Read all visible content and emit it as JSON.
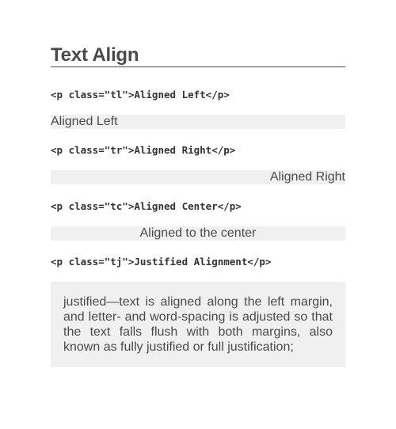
{
  "page": {
    "title": "Text Align"
  },
  "examples": [
    {
      "code": "<p class=\"tl\">Aligned Left</p>",
      "text": "Aligned Left"
    },
    {
      "code": "<p class=\"tr\">Aligned Right</p>",
      "text": "Aligned Right"
    },
    {
      "code": "<p class=\"tc\">Aligned Center</p>",
      "text": "Aligned to the center"
    },
    {
      "code": "<p class=\"tj\">Justified Alignment</p>",
      "text": "justified—text is aligned along the left margin, and letter- and word-spacing is adjusted so that the text falls flush with both margins, also known as fully justified or full justification;"
    }
  ],
  "colors": {
    "text": "#4a4a4a",
    "code": "#333333",
    "demo_background": "#f0f0f0",
    "page_background": "#ffffff"
  }
}
